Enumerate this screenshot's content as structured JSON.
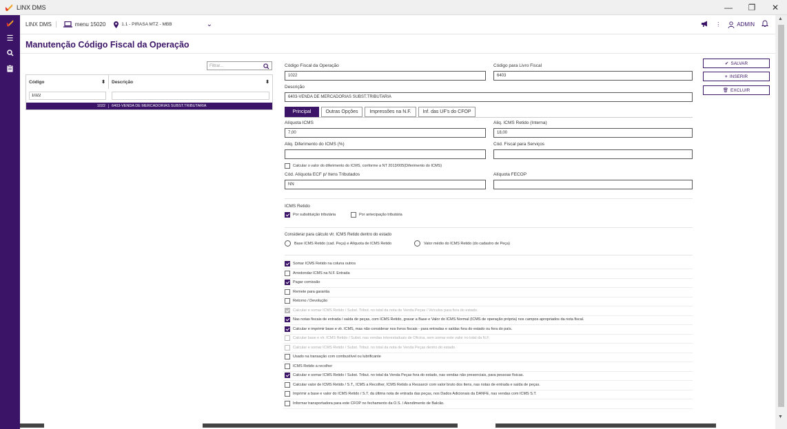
{
  "window": {
    "title": "LINX DMS",
    "minimize": "—",
    "maximize": "❐",
    "close": "✕"
  },
  "topbar": {
    "brand": "LINX DMS",
    "menu_label": "menu 15020",
    "location": "1.1 - PIRASA MTZ - MBB",
    "user": "ADMIN"
  },
  "page": {
    "title": "Manutenção Código Fiscal da Operação"
  },
  "filter": {
    "placeholder": "Filtrar..."
  },
  "grid": {
    "columns": [
      "Código",
      "Descrição"
    ],
    "filter_codigo": "1022",
    "filter_descricao": "",
    "rows": [
      {
        "codigo": "1022",
        "descricao": "6403-VENDA DE MERCADORIAS SUBST.TRIBUTARIA"
      }
    ]
  },
  "form": {
    "cfop_label": "Código Fiscal da Operação",
    "cfop_value": "1022",
    "livro_label": "Código para Livro Fiscal",
    "livro_value": "6403",
    "descricao_label": "Descrição",
    "descricao_value": "6403-VENDA DE MERCADORIAS SUBST.TRIBUTARIA"
  },
  "tabs": [
    "Principal",
    "Outras Opções",
    "Impressões na N.F.",
    "Inf. das UF's do CFOP"
  ],
  "principal": {
    "aliq_icms_label": "Alíquota ICMS",
    "aliq_icms_value": "7,00",
    "aliq_retido_label": "Aliq. ICMS Retido (Interna)",
    "aliq_retido_value": "18,00",
    "aliq_diferimento_label": "Aliq. Diferimento do ICMS (%)",
    "aliq_diferimento_value": "",
    "cod_servicos_label": "Cód. Fiscal para Serviços",
    "cod_servicos_value": "",
    "calc_diferimento_label": "Calcular o valor do diferimento do ICMS, conforme a NT 2013/005(Diferimento do ICMS)",
    "cod_ecf_label": "Cód. Alíquota ECF p/ Itens Tributados",
    "cod_ecf_value": "NN",
    "fecop_label": "Alíquota FECOP",
    "fecop_value": "",
    "icms_retido_label": "ICMS Retido",
    "por_substituicao_label": "Por substituição tributária",
    "por_antecipacao_label": "Por antecipação tributária",
    "considerar_label": "Considerar para cálculo vlr. ICMS Retido dentro do estado",
    "radio_base_label": "Base ICMS Retido (cad. Peça) e Alíquota de ICMS Retido",
    "radio_medio_label": "Valor médio do ICMS Retido (do cadastro de Peça)",
    "options": [
      {
        "label": "Somar ICMS Retido na coluna outros",
        "checked": true,
        "disabled": false
      },
      {
        "label": "Arredondar ICMS na N.F. Entrada",
        "checked": false,
        "disabled": false
      },
      {
        "label": "Pagar comissão",
        "checked": true,
        "disabled": false
      },
      {
        "label": "Remete para garantia",
        "checked": false,
        "disabled": false
      },
      {
        "label": "Retorno / Devolução",
        "checked": false,
        "disabled": false
      },
      {
        "label": "Calcular e somar ICMS Retido / Subst. Tribut. no total da nota de Venda Peças / Veículos para fora do estado.",
        "checked": true,
        "disabled": true
      },
      {
        "label": "Nas notas fiscais de entrada / saída de peças, com ICMS Retido, gravar a Base e Valor do ICMS Normal (ICMS de operação própria) nos campos apropriados da nota fiscal.",
        "checked": true,
        "disabled": false
      },
      {
        "label": "Calcular e imprimir base e vlr. ICMS, mas não considerar nos livros fiscais - para entradas e saídas fora do estado ou fora do país.",
        "checked": true,
        "disabled": false
      },
      {
        "label": "Calcular base e vlr. ICMS Retido / Subst. nas vendas interestaduais de Oficina, sem somar este valor no total da N.F.",
        "checked": false,
        "disabled": true
      },
      {
        "label": "Calcular e somar ICMS Retido / Subst. Tribut. no total da nota de Venda Peças dentro do estado.",
        "checked": false,
        "disabled": true
      },
      {
        "label": "Usado na transação com combustível ou lubrificante",
        "checked": false,
        "disabled": false
      },
      {
        "label": "ICMS Retido a recolher",
        "checked": false,
        "disabled": false
      },
      {
        "label": "Calcular e somar ICMS Retido / Subst. Tribut. no total da Venda Peças fora do estado, nas vendas não presenciais, para pessoas físicas.",
        "checked": true,
        "disabled": false
      },
      {
        "label": "Calcular valor de ICMS Retido / S.T., ICMS a Recolher, ICMS Retido a Ressarcir com valor bruto dos itens, nas notas de entrada e saída de peças.",
        "checked": false,
        "disabled": false
      },
      {
        "label": "Imprimir a base e valor do ICMS Retido / S.T. da última nota de entrada das peças, nos Dados Adicionais da DANFE, nas vendas com ICMS S.T.",
        "checked": false,
        "disabled": false
      },
      {
        "label": "Informar transportadora para este CFOP no fechamento da O.S. / Atendimento de Balcão.",
        "checked": false,
        "disabled": false
      }
    ]
  },
  "actions": {
    "save": "SALVAR",
    "insert": "INSERIR",
    "delete": "EXCLUIR"
  },
  "colors": {
    "accent": "#3b1467",
    "logo": "#f0a020"
  }
}
